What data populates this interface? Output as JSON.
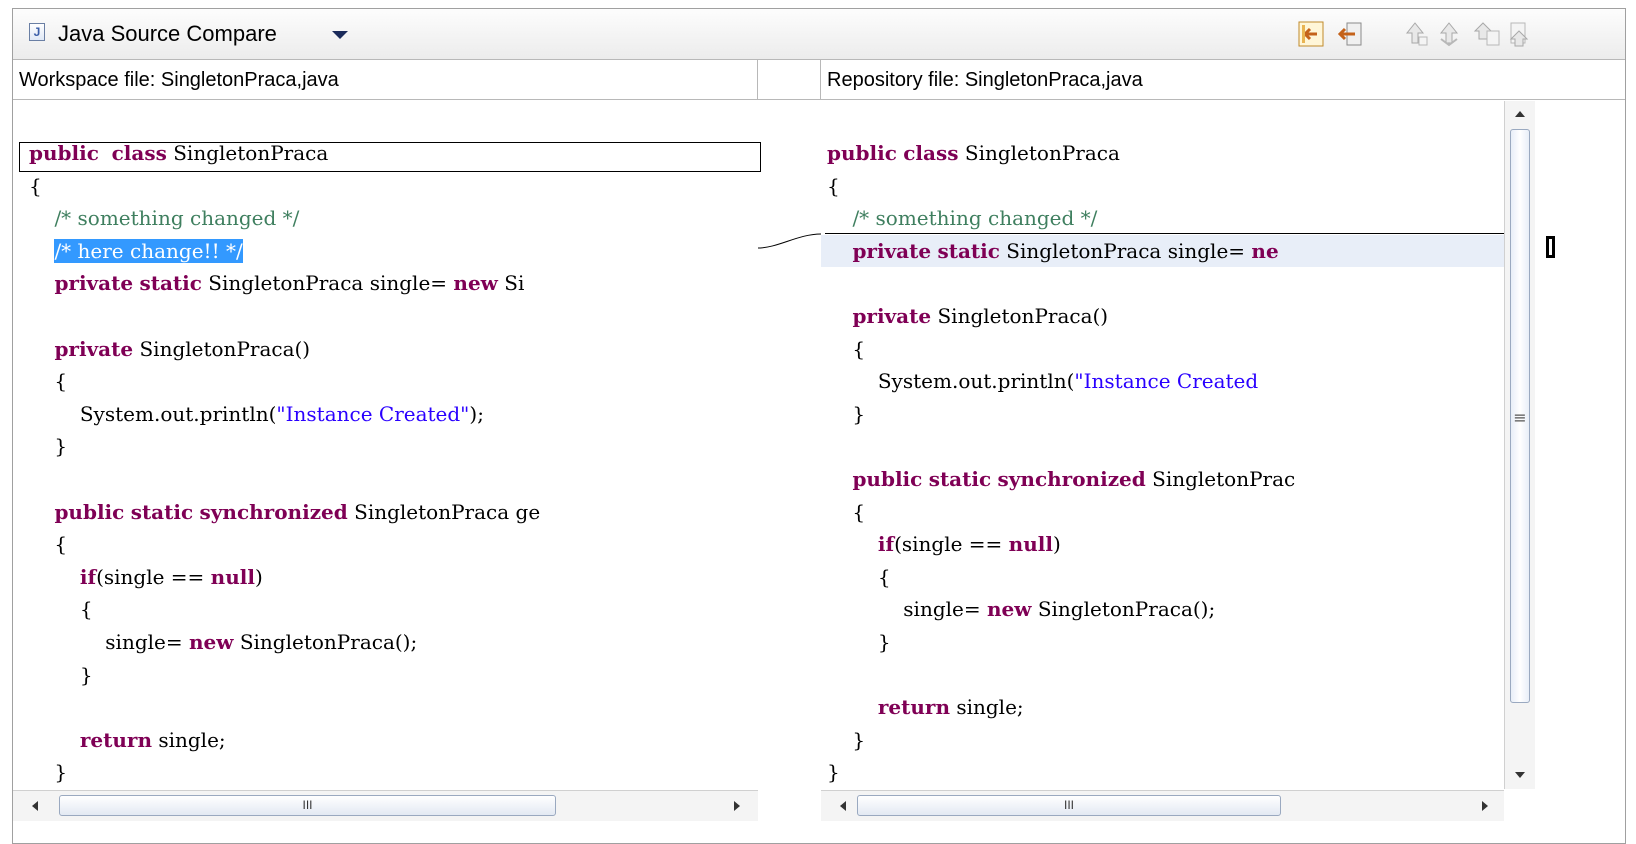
{
  "window": {
    "title": "Java Source Compare",
    "title_icon": "java-file-icon",
    "menu_icon": "chevron-down-icon"
  },
  "toolbar": {
    "buttons": [
      {
        "name": "copy-all-from-right-button",
        "icon": "copy-all-left-icon",
        "enabled": true
      },
      {
        "name": "copy-current-change-button",
        "icon": "copy-change-left-icon",
        "enabled": true
      },
      {
        "name": "next-difference-button",
        "icon": "next-diff-icon",
        "enabled": false
      },
      {
        "name": "previous-difference-button",
        "icon": "prev-diff-icon",
        "enabled": false
      },
      {
        "name": "next-change-button",
        "icon": "next-change-icon",
        "enabled": false
      },
      {
        "name": "previous-change-button",
        "icon": "prev-change-icon",
        "enabled": false
      }
    ]
  },
  "left": {
    "header": "Workspace file: SingletonPraca,java",
    "lines": [
      {
        "t": [
          [
            "kw",
            "public"
          ],
          [
            "",
            "  "
          ],
          [
            "kw",
            "class"
          ],
          [
            "",
            " SingletonPraca"
          ]
        ]
      },
      {
        "t": [
          [
            "",
            "{"
          ]
        ]
      },
      {
        "t": [
          [
            "",
            "    "
          ],
          [
            "cm",
            "/* something changed */"
          ]
        ]
      },
      {
        "t": [
          [
            "",
            "    "
          ],
          [
            "sel",
            "/* here change!! */"
          ]
        ],
        "row": "selected"
      },
      {
        "t": [
          [
            "",
            "    "
          ],
          [
            "kw",
            "private"
          ],
          [
            "",
            " "
          ],
          [
            "kw",
            "static"
          ],
          [
            "",
            " SingletonPraca single= "
          ],
          [
            "kw",
            "new"
          ],
          [
            "",
            " Si"
          ]
        ]
      },
      {
        "t": [
          [
            "",
            ""
          ]
        ]
      },
      {
        "t": [
          [
            "",
            "    "
          ],
          [
            "kw",
            "private"
          ],
          [
            "",
            " SingletonPraca()"
          ]
        ]
      },
      {
        "t": [
          [
            "",
            "    {"
          ]
        ]
      },
      {
        "t": [
          [
            "",
            "        System.out.println("
          ],
          [
            "st",
            "\"Instance Created\""
          ],
          [
            "",
            ");"
          ]
        ]
      },
      {
        "t": [
          [
            "",
            "    }"
          ]
        ]
      },
      {
        "t": [
          [
            "",
            ""
          ]
        ]
      },
      {
        "t": [
          [
            "",
            "    "
          ],
          [
            "kw",
            "public"
          ],
          [
            "",
            " "
          ],
          [
            "kw",
            "static"
          ],
          [
            "",
            " "
          ],
          [
            "kw",
            "synchronized"
          ],
          [
            "",
            " SingletonPraca ge"
          ]
        ]
      },
      {
        "t": [
          [
            "",
            "    {"
          ]
        ]
      },
      {
        "t": [
          [
            "",
            "        "
          ],
          [
            "kw",
            "if"
          ],
          [
            "",
            "(single == "
          ],
          [
            "kw",
            "null"
          ],
          [
            "",
            ")"
          ]
        ]
      },
      {
        "t": [
          [
            "",
            "        {"
          ]
        ]
      },
      {
        "t": [
          [
            "",
            "            single= "
          ],
          [
            "kw",
            "new"
          ],
          [
            "",
            " SingletonPraca();"
          ]
        ]
      },
      {
        "t": [
          [
            "",
            "        }"
          ]
        ]
      },
      {
        "t": [
          [
            "",
            ""
          ]
        ]
      },
      {
        "t": [
          [
            "",
            "        "
          ],
          [
            "kw",
            "return"
          ],
          [
            "",
            " single;"
          ]
        ]
      },
      {
        "t": [
          [
            "",
            "    }"
          ]
        ]
      }
    ]
  },
  "right": {
    "header": "Repository file: SingletonPraca,java",
    "lines": [
      {
        "t": [
          [
            "kw",
            "public"
          ],
          [
            "",
            " "
          ],
          [
            "kw",
            "class"
          ],
          [
            "",
            " SingletonPraca"
          ]
        ]
      },
      {
        "t": [
          [
            "",
            "{"
          ]
        ]
      },
      {
        "t": [
          [
            "",
            "    "
          ],
          [
            "cm",
            "/* something changed */"
          ]
        ]
      },
      {
        "t": [
          [
            "",
            "    "
          ],
          [
            "kw",
            "private"
          ],
          [
            "",
            " "
          ],
          [
            "kw",
            "static"
          ],
          [
            "",
            " SingletonPraca single= "
          ],
          [
            "kw",
            "ne"
          ]
        ],
        "row": "highlight"
      },
      {
        "t": [
          [
            "",
            ""
          ]
        ]
      },
      {
        "t": [
          [
            "",
            "    "
          ],
          [
            "kw",
            "private"
          ],
          [
            "",
            " SingletonPraca()"
          ]
        ]
      },
      {
        "t": [
          [
            "",
            "    {"
          ]
        ]
      },
      {
        "t": [
          [
            "",
            "        System.out.println("
          ],
          [
            "st",
            "\"Instance Created"
          ]
        ]
      },
      {
        "t": [
          [
            "",
            "    }"
          ]
        ]
      },
      {
        "t": [
          [
            "",
            ""
          ]
        ]
      },
      {
        "t": [
          [
            "",
            "    "
          ],
          [
            "kw",
            "public"
          ],
          [
            "",
            " "
          ],
          [
            "kw",
            "static"
          ],
          [
            "",
            " "
          ],
          [
            "kw",
            "synchronized"
          ],
          [
            "",
            " SingletonPrac"
          ]
        ]
      },
      {
        "t": [
          [
            "",
            "    {"
          ]
        ]
      },
      {
        "t": [
          [
            "",
            "        "
          ],
          [
            "kw",
            "if"
          ],
          [
            "",
            "(single == "
          ],
          [
            "kw",
            "null"
          ],
          [
            "",
            ")"
          ]
        ]
      },
      {
        "t": [
          [
            "",
            "        {"
          ]
        ]
      },
      {
        "t": [
          [
            "",
            "            single= "
          ],
          [
            "kw",
            "new"
          ],
          [
            "",
            " SingletonPraca();"
          ]
        ]
      },
      {
        "t": [
          [
            "",
            "        }"
          ]
        ]
      },
      {
        "t": [
          [
            "",
            ""
          ]
        ]
      },
      {
        "t": [
          [
            "",
            "        "
          ],
          [
            "kw",
            "return"
          ],
          [
            "",
            " single;"
          ]
        ]
      },
      {
        "t": [
          [
            "",
            "    }"
          ]
        ]
      },
      {
        "t": [
          [
            "",
            "}"
          ]
        ]
      }
    ]
  },
  "scrollbars": {
    "thumb_grip": "III",
    "vertical_grip": "≡"
  },
  "colors": {
    "keyword": "#7f0055",
    "comment": "#3f7f5f",
    "string": "#2a00ff",
    "selection": "#3399ff",
    "diff_highlight": "#e8eef8"
  }
}
